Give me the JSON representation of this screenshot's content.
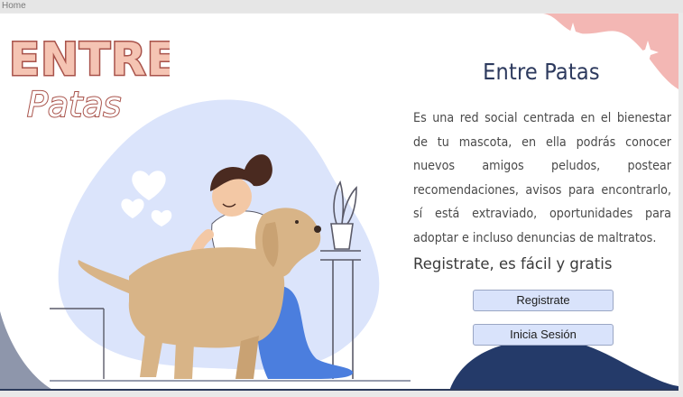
{
  "tab": {
    "label": "Home"
  },
  "logo": {
    "line1": "ENTRE",
    "line2": "Patas"
  },
  "main": {
    "title": "Entre Patas",
    "description": "Es una red social centrada en el bienestar de tu mascota, en ella podrás conocer nuevos amigos peludos, postear recomendaciones, avisos para encontrarlo, sí está extraviado, oportunidades para adoptar e incluso denuncias de maltratos.",
    "tagline": "Registrate, es fácil y gratis"
  },
  "buttons": {
    "register": "Registrate",
    "login": "Inicia Sesión"
  },
  "colors": {
    "accent_navy": "#2d3a5e",
    "blob_blue": "#dbe4fb",
    "pink": "#f3b7b4",
    "button_bg": "#d9e3fb"
  }
}
